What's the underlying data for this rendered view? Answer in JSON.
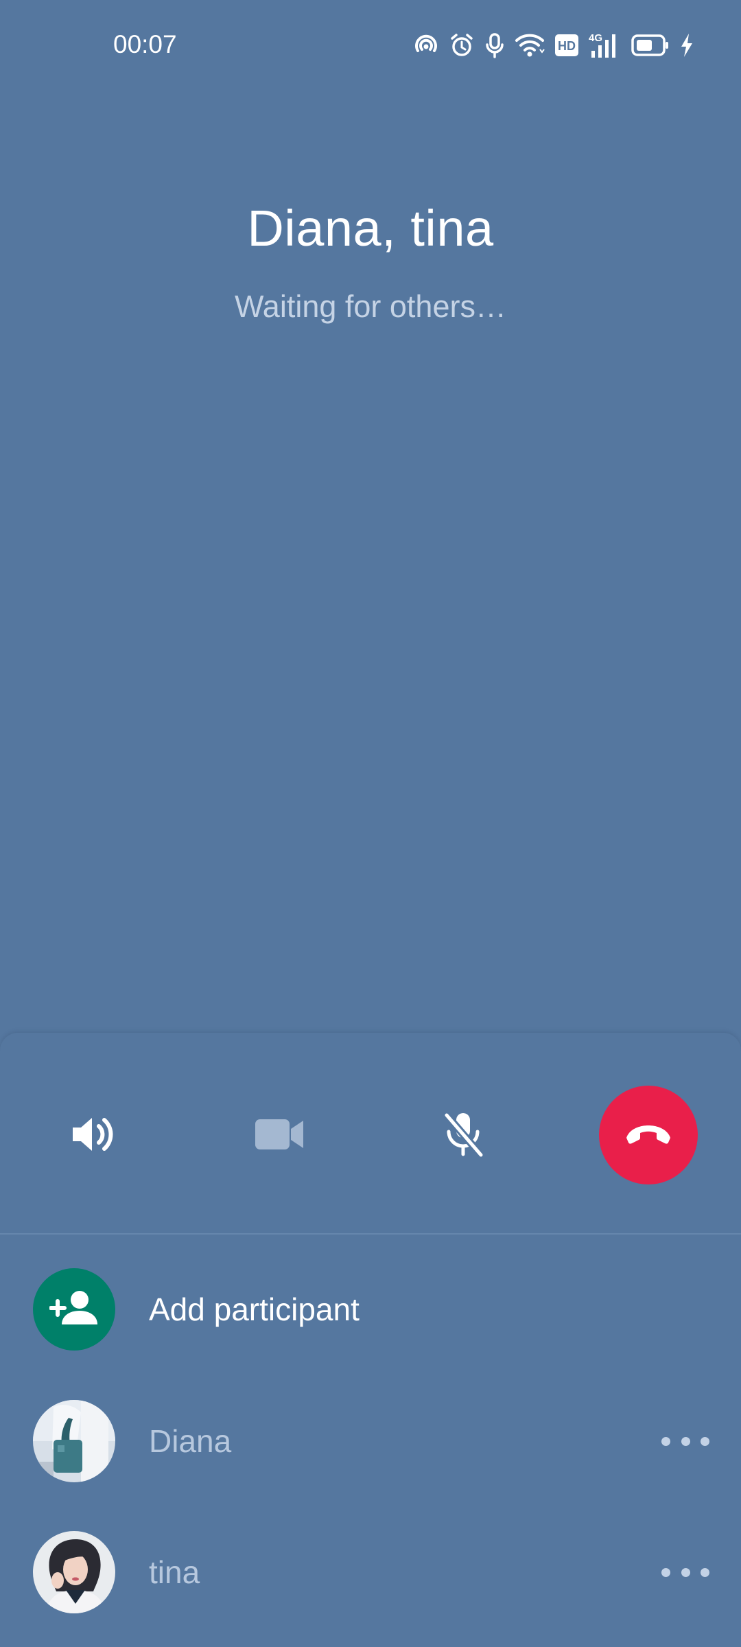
{
  "status_bar": {
    "time": "00:07",
    "icons": [
      "hotspot-icon",
      "alarm-icon",
      "microphone-icon",
      "wifi-icon",
      "hd-icon",
      "signal-4g-icon",
      "battery-icon",
      "charging-icon"
    ],
    "hd_label": "HD",
    "network_label": "4G"
  },
  "call": {
    "title": "Diana, tina",
    "status": "Waiting for others…"
  },
  "controls": {
    "speaker": "speaker-icon",
    "video": "video-camera-icon",
    "mute": "microphone-off-icon",
    "end_call": "end-call-icon"
  },
  "participants_panel": {
    "add_label": "Add participant",
    "participants": [
      {
        "name": "Diana"
      },
      {
        "name": "tina"
      }
    ]
  },
  "colors": {
    "background": "#55779f",
    "end_call": "#e91f4a",
    "add_participant": "#008069",
    "muted_text": "#b7c8de"
  }
}
